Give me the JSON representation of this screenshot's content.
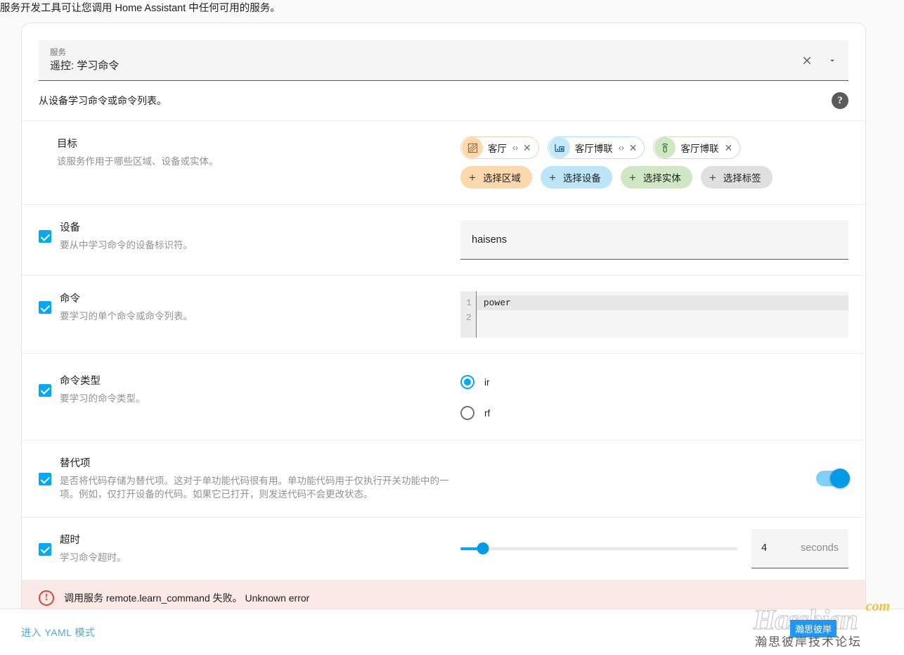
{
  "intro": "服务开发工具可让您调用 Home Assistant 中任何可用的服务。",
  "service_picker": {
    "label": "服务",
    "value": "遥控: 学习命令",
    "clear_icon": "close-icon",
    "dropdown_icon": "chevron-down-icon"
  },
  "service_description": "从设备学习命令或命令列表。",
  "help_icon_label": "?",
  "target": {
    "title": "目标",
    "description": "该服务作用于哪些区域、设备或实体。",
    "chips": [
      {
        "type": "area",
        "icon": "area-icon",
        "text": "客厅",
        "expand": "‹›",
        "close": "✕"
      },
      {
        "type": "device",
        "icon": "device-icon",
        "text": "客厅博联",
        "expand": "‹›",
        "close": "✕"
      },
      {
        "type": "entity",
        "icon": "remote-icon",
        "text": "客厅博联",
        "expand": "",
        "close": "✕"
      }
    ],
    "add_buttons": [
      {
        "type": "area",
        "label": "选择区域"
      },
      {
        "type": "device",
        "label": "选择设备"
      },
      {
        "type": "entity",
        "label": "选择实体"
      },
      {
        "type": "label",
        "label": "选择标签"
      }
    ]
  },
  "device_field": {
    "title": "设备",
    "description": "要从中学习命令的设备标识符。",
    "value": "haisens",
    "checked": true
  },
  "command_field": {
    "title": "命令",
    "description": "要学习的单个命令或命令列表。",
    "checked": true,
    "lines": [
      "power",
      ""
    ],
    "line_numbers": [
      "1",
      "2"
    ]
  },
  "command_type_field": {
    "title": "命令类型",
    "description": "要学习的命令类型。",
    "checked": true,
    "selected": "ir",
    "options": [
      {
        "value": "ir",
        "label": "ir",
        "selected": true
      },
      {
        "value": "rf",
        "label": "rf",
        "selected": false
      }
    ]
  },
  "alternative_field": {
    "title": "替代项",
    "description": "是否将代码存储为替代项。这对于单功能代码很有用。单功能代码用于仅执行开关功能中的一项。例如，仅打开设备的代码。如果它已打开，则发送代码不会更改状态。",
    "checked": true,
    "toggle_on": true
  },
  "timeout_field": {
    "title": "超时",
    "description": "学习命令超时。",
    "checked": true,
    "value": "4",
    "unit": "seconds",
    "slider_percent": 8
  },
  "error": {
    "icon": "alert-circle-icon",
    "text": "调用服务 remote.learn_command 失败。  Unknown error"
  },
  "footer": {
    "yaml_link": "进入 YAML 模式"
  },
  "watermark": {
    "main": "Hassbian",
    "tld": "com",
    "badge": "瀚思彼岸",
    "sub": "瀚思彼岸技术论坛"
  },
  "colors": {
    "accent": "#03a9f4",
    "error": "#db4437",
    "error_bg": "#fbe9e7",
    "area": "#fbd9ac",
    "device": "#bce5f7",
    "entity": "#cfe7c2",
    "label": "#e0e0e0"
  }
}
